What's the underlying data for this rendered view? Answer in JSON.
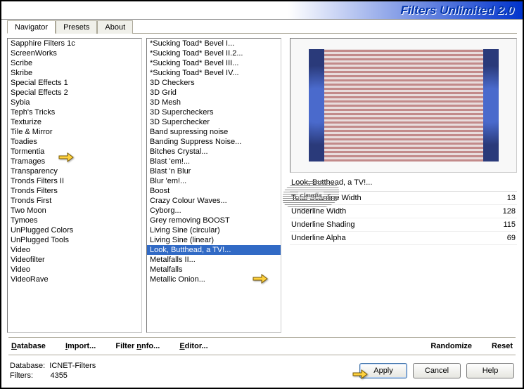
{
  "title": "Filters Unlimited 2.0",
  "tabs": [
    "Navigator",
    "Presets",
    "About"
  ],
  "categories": [
    "Sapphire Filters 1c",
    "ScreenWorks",
    "Scribe",
    "Skribe",
    "Special Effects 1",
    "Special Effects 2",
    "Sybia",
    "Teph's Tricks",
    "Texturize",
    "Tile & Mirror",
    "Toadies",
    "Tormentia",
    "Tramages",
    "Transparency",
    "Tronds Filters II",
    "Tronds Filters",
    "Tronds First",
    "Two Moon",
    "Tymoes",
    "UnPlugged Colors",
    "UnPlugged Tools",
    "Video",
    "Videofilter",
    "Video",
    "VideoRave"
  ],
  "category_selected": "Toadies",
  "filters": [
    "*Sucking Toad*  Bevel I...",
    "*Sucking Toad*  Bevel II.2...",
    "*Sucking Toad*  Bevel III...",
    "*Sucking Toad*  Bevel IV...",
    "3D Checkers",
    "3D Grid",
    "3D Mesh",
    "3D Supercheckers",
    "3D Superchecker",
    "Band supressing noise",
    "Banding Suppress Noise...",
    "Bitches Crystal...",
    "Blast 'em!...",
    "Blast 'n Blur",
    "Blur 'em!...",
    "Boost",
    "Crazy Colour Waves...",
    "Cyborg...",
    "Grey removing BOOST",
    "Living Sine (circular)",
    "Living Sine (linear)",
    "Look, Butthead, a TV!...",
    "Metalfalls II...",
    "Metalfalls",
    "Metallic Onion..."
  ],
  "filter_selected": "Look, Butthead, a TV!...",
  "selected_filter_label": "Look, Butthead, a TV!...",
  "params": [
    {
      "label": "Total Scanline Width",
      "value": "13"
    },
    {
      "label": "Underline Width",
      "value": "128"
    },
    {
      "label": "Underline Shading",
      "value": "115"
    },
    {
      "label": "Underline Alpha",
      "value": "69"
    }
  ],
  "links": {
    "database": "Database",
    "import": "Import...",
    "filterinfo": "Filter Info...",
    "editor": "Editor...",
    "randomize": "Randomize",
    "reset": "Reset"
  },
  "footer": {
    "db_label": "Database:",
    "db_value": "ICNET-Filters",
    "filters_label": "Filters:",
    "filters_value": "4355"
  },
  "buttons": {
    "apply": "Apply",
    "cancel": "Cancel",
    "help": "Help"
  },
  "watermark": "claudia"
}
